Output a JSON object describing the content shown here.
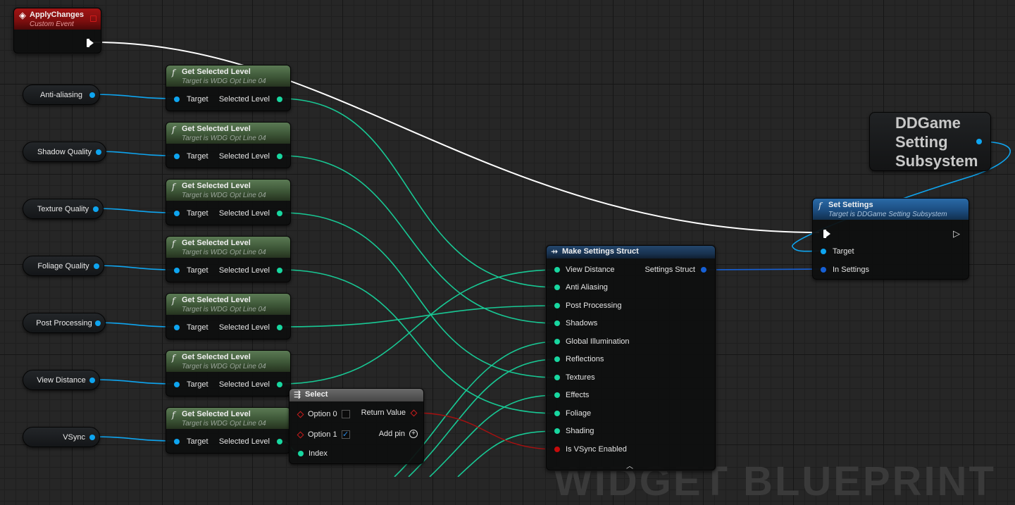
{
  "watermark": "WIDGET BLUEPRINT",
  "custom_event": {
    "title": "ApplyChanges",
    "subtitle": "Custom Event"
  },
  "variables": [
    "Anti-aliasing",
    "Shadow Quality",
    "Texture Quality",
    "Foliage Quality",
    "Post Processing",
    "View Distance",
    "VSync"
  ],
  "get_level": {
    "title": "Get Selected Level",
    "subtitle": "Target is WDG Opt Line 04",
    "in_pin": "Target",
    "out_pin": "Selected Level"
  },
  "select": {
    "title": "Select",
    "option0": "Option 0",
    "option1": "Option 1",
    "index": "Index",
    "return_value": "Return Value",
    "add_pin": "Add pin",
    "check": "✓"
  },
  "make_struct": {
    "title": "Make Settings Struct",
    "output": "Settings Struct",
    "inputs": [
      "View Distance",
      "Anti Aliasing",
      "Post Processing",
      "Shadows",
      "Global Illumination",
      "Reflections",
      "Textures",
      "Effects",
      "Foliage",
      "Shading",
      "Is VSync Enabled"
    ],
    "collapse_icon": "chevron-up-icon"
  },
  "subsystem": {
    "title": "DDGame Setting Subsystem"
  },
  "set_settings": {
    "title": "Set Settings",
    "subtitle": "Target is DDGame Setting Subsystem",
    "target": "Target",
    "in_settings": "In Settings"
  },
  "colors": {
    "exec": "#ffffff",
    "float_pin": "#18d7a0",
    "object_pin": "#0ea5f0",
    "struct_pin": "#1660d6",
    "bool_pin": "#c60b0b",
    "function_header": "#3d5637",
    "event_header": "#7c0e0e"
  }
}
